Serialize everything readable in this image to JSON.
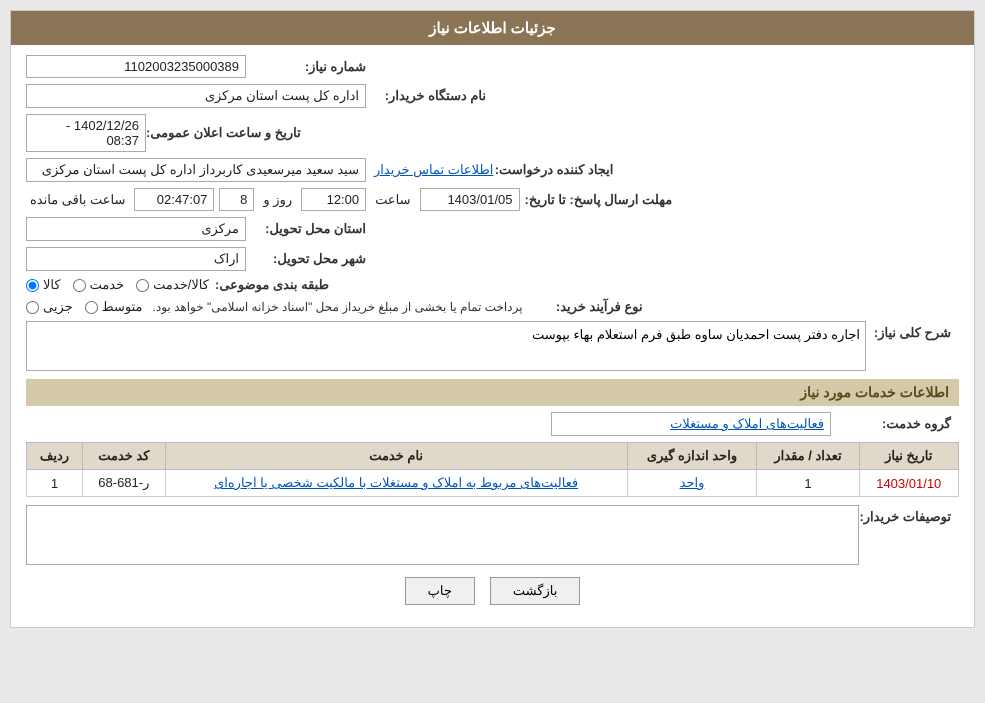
{
  "header": {
    "title": "جزئیات اطلاعات نیاز"
  },
  "fields": {
    "shomare_niaz_label": "شماره نیاز:",
    "shomare_niaz_value": "1102003235000389",
    "nam_dastgah_label": "نام دستگاه خریدار:",
    "nam_dastgah_value": "اداره کل پست استان مرکزی",
    "tarikh_elan_label": "تاریخ و ساعت اعلان عمومی:",
    "tarikh_elan_from": "1402/12/26 - 08:37",
    "ijad_label": "ایجاد کننده درخواست:",
    "ijad_value": "سید سعید میرسعیدی کاربرداز اداره کل پست استان مرکزی",
    "ettelaat_label": "اطلاعات تماس خریدار",
    "mohlat_label": "مهلت ارسال پاسخ: تا تاریخ:",
    "date_value": "1403/01/05",
    "saat_label": "ساعت",
    "saat_value": "12:00",
    "rooz_label": "روز و",
    "rooz_value": "8",
    "baqi_label": "ساعت باقی مانده",
    "baqi_value": "02:47:07",
    "ostan_label": "استان محل تحویل:",
    "ostan_value": "مرکزی",
    "shahr_label": "شهر محل تحویل:",
    "shahr_value": "اراک",
    "tabaghebandi_label": "طبقه بندی موضوعی:",
    "kala_label": "کالا",
    "khedmat_label": "خدمت",
    "kala_khedmat_label": "کالا/خدمت",
    "noefrayand_label": "نوع فرآیند خرید:",
    "jozi_label": "جزیی",
    "motavasset_label": "متوسط",
    "noefrayand_desc": "پرداخت تمام یا بخشی از مبلغ خریداز محل \"اسناد خزانه اسلامی\" خواهد بود.",
    "sharh_label": "شرح کلی نیاز:",
    "sharh_value": "اجاره دفتر پست احمدیان ساوه طبق فرم استعلام بهاء بپوست",
    "services_section_title": "اطلاعات خدمات مورد نیاز",
    "group_label": "گروه خدمت:",
    "group_value": "فعالیت‌های  املاک و مستغلات",
    "table_headers": {
      "radif": "ردیف",
      "code_khedmat": "کد خدمت",
      "name_khedmat": "نام خدمت",
      "vahad": "واحد اندازه گیری",
      "tedaad": "تعداد / مقدار",
      "tarikh": "تاریخ نیاز"
    },
    "table_rows": [
      {
        "radif": "1",
        "code_khedmat": "ر-681-68",
        "name_khedmat": "فعالیت‌های مربوط به املاک و مستغلات با مالکیت شخصی یا اجاره‌ای",
        "vahad": "واحد",
        "tedaad": "1",
        "tarikh": "1403/01/10"
      }
    ],
    "tozihat_label": "توصیفات خریدار:"
  },
  "buttons": {
    "print": "چاپ",
    "back": "بازگشت"
  }
}
